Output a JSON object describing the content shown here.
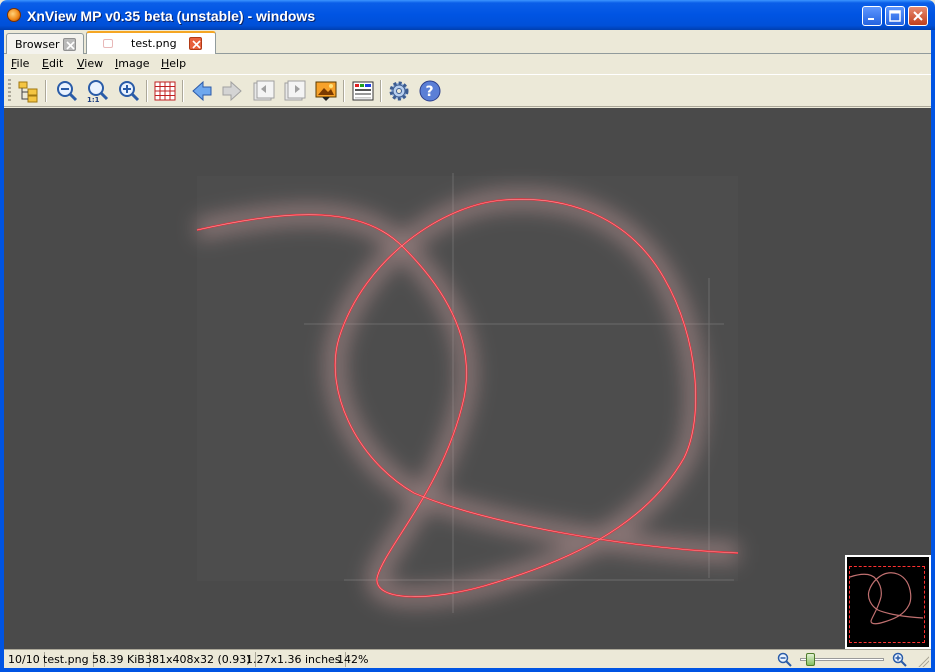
{
  "window": {
    "title": "XnView MP v0.35 beta (unstable) - windows",
    "icon": "xnview-app-icon",
    "controls": [
      "minimize-icon",
      "maximize-icon",
      "close-icon"
    ]
  },
  "tabs": [
    {
      "label": "Browser",
      "active": false
    },
    {
      "label": "test.png",
      "active": true
    }
  ],
  "menu": [
    {
      "label": "File",
      "accel": "F",
      "rest": "ile"
    },
    {
      "label": "Edit",
      "accel": "E",
      "rest": "dit"
    },
    {
      "label": "View",
      "accel": "V",
      "rest": "iew"
    },
    {
      "label": "Image",
      "accel": "I",
      "rest": "mage"
    },
    {
      "label": "Help",
      "accel": "H",
      "rest": "elp"
    }
  ],
  "toolbar": {
    "buttons": [
      "browser-tree-icon",
      "zoom-out-icon",
      "zoom-actual-size-icon",
      "zoom-in-icon",
      "grid-icon",
      "previous-arrow-icon",
      "next-arrow-icon",
      "first-page-icon",
      "last-page-icon",
      "slideshow-icon",
      "color-adjust-icon",
      "settings-gear-icon",
      "help-icon"
    ]
  },
  "statusbar": {
    "position": "10/10",
    "filename": "test.png",
    "filesize": "58.39 KiB",
    "dimensions": "381x408x32 (0.93)",
    "print_size": "1.27x1.36 inches",
    "zoom": "142%"
  },
  "colors": {
    "titlebar": "#0054e3",
    "viewer_bg": "#4a4a4a",
    "curve": "#e8303c",
    "tab_active_accent": "#f5a623"
  }
}
